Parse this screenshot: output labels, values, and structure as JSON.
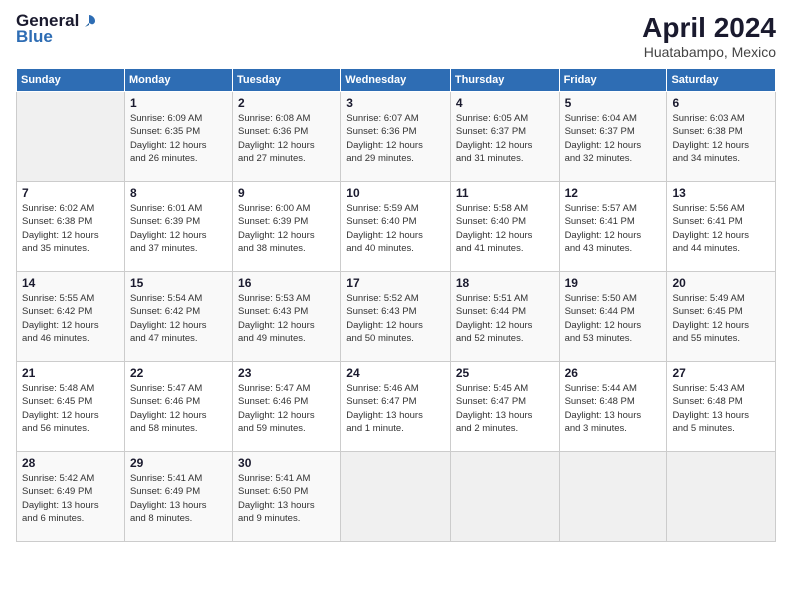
{
  "app": {
    "logo_general": "General",
    "logo_blue": "Blue",
    "title": "April 2024",
    "subtitle": "Huatabampo, Mexico"
  },
  "calendar": {
    "headers": [
      "Sunday",
      "Monday",
      "Tuesday",
      "Wednesday",
      "Thursday",
      "Friday",
      "Saturday"
    ],
    "weeks": [
      [
        {
          "day": "",
          "info": ""
        },
        {
          "day": "1",
          "info": "Sunrise: 6:09 AM\nSunset: 6:35 PM\nDaylight: 12 hours\nand 26 minutes."
        },
        {
          "day": "2",
          "info": "Sunrise: 6:08 AM\nSunset: 6:36 PM\nDaylight: 12 hours\nand 27 minutes."
        },
        {
          "day": "3",
          "info": "Sunrise: 6:07 AM\nSunset: 6:36 PM\nDaylight: 12 hours\nand 29 minutes."
        },
        {
          "day": "4",
          "info": "Sunrise: 6:05 AM\nSunset: 6:37 PM\nDaylight: 12 hours\nand 31 minutes."
        },
        {
          "day": "5",
          "info": "Sunrise: 6:04 AM\nSunset: 6:37 PM\nDaylight: 12 hours\nand 32 minutes."
        },
        {
          "day": "6",
          "info": "Sunrise: 6:03 AM\nSunset: 6:38 PM\nDaylight: 12 hours\nand 34 minutes."
        }
      ],
      [
        {
          "day": "7",
          "info": "Sunrise: 6:02 AM\nSunset: 6:38 PM\nDaylight: 12 hours\nand 35 minutes."
        },
        {
          "day": "8",
          "info": "Sunrise: 6:01 AM\nSunset: 6:39 PM\nDaylight: 12 hours\nand 37 minutes."
        },
        {
          "day": "9",
          "info": "Sunrise: 6:00 AM\nSunset: 6:39 PM\nDaylight: 12 hours\nand 38 minutes."
        },
        {
          "day": "10",
          "info": "Sunrise: 5:59 AM\nSunset: 6:40 PM\nDaylight: 12 hours\nand 40 minutes."
        },
        {
          "day": "11",
          "info": "Sunrise: 5:58 AM\nSunset: 6:40 PM\nDaylight: 12 hours\nand 41 minutes."
        },
        {
          "day": "12",
          "info": "Sunrise: 5:57 AM\nSunset: 6:41 PM\nDaylight: 12 hours\nand 43 minutes."
        },
        {
          "day": "13",
          "info": "Sunrise: 5:56 AM\nSunset: 6:41 PM\nDaylight: 12 hours\nand 44 minutes."
        }
      ],
      [
        {
          "day": "14",
          "info": "Sunrise: 5:55 AM\nSunset: 6:42 PM\nDaylight: 12 hours\nand 46 minutes."
        },
        {
          "day": "15",
          "info": "Sunrise: 5:54 AM\nSunset: 6:42 PM\nDaylight: 12 hours\nand 47 minutes."
        },
        {
          "day": "16",
          "info": "Sunrise: 5:53 AM\nSunset: 6:43 PM\nDaylight: 12 hours\nand 49 minutes."
        },
        {
          "day": "17",
          "info": "Sunrise: 5:52 AM\nSunset: 6:43 PM\nDaylight: 12 hours\nand 50 minutes."
        },
        {
          "day": "18",
          "info": "Sunrise: 5:51 AM\nSunset: 6:44 PM\nDaylight: 12 hours\nand 52 minutes."
        },
        {
          "day": "19",
          "info": "Sunrise: 5:50 AM\nSunset: 6:44 PM\nDaylight: 12 hours\nand 53 minutes."
        },
        {
          "day": "20",
          "info": "Sunrise: 5:49 AM\nSunset: 6:45 PM\nDaylight: 12 hours\nand 55 minutes."
        }
      ],
      [
        {
          "day": "21",
          "info": "Sunrise: 5:48 AM\nSunset: 6:45 PM\nDaylight: 12 hours\nand 56 minutes."
        },
        {
          "day": "22",
          "info": "Sunrise: 5:47 AM\nSunset: 6:46 PM\nDaylight: 12 hours\nand 58 minutes."
        },
        {
          "day": "23",
          "info": "Sunrise: 5:47 AM\nSunset: 6:46 PM\nDaylight: 12 hours\nand 59 minutes."
        },
        {
          "day": "24",
          "info": "Sunrise: 5:46 AM\nSunset: 6:47 PM\nDaylight: 13 hours\nand 1 minute."
        },
        {
          "day": "25",
          "info": "Sunrise: 5:45 AM\nSunset: 6:47 PM\nDaylight: 13 hours\nand 2 minutes."
        },
        {
          "day": "26",
          "info": "Sunrise: 5:44 AM\nSunset: 6:48 PM\nDaylight: 13 hours\nand 3 minutes."
        },
        {
          "day": "27",
          "info": "Sunrise: 5:43 AM\nSunset: 6:48 PM\nDaylight: 13 hours\nand 5 minutes."
        }
      ],
      [
        {
          "day": "28",
          "info": "Sunrise: 5:42 AM\nSunset: 6:49 PM\nDaylight: 13 hours\nand 6 minutes."
        },
        {
          "day": "29",
          "info": "Sunrise: 5:41 AM\nSunset: 6:49 PM\nDaylight: 13 hours\nand 8 minutes."
        },
        {
          "day": "30",
          "info": "Sunrise: 5:41 AM\nSunset: 6:50 PM\nDaylight: 13 hours\nand 9 minutes."
        },
        {
          "day": "",
          "info": ""
        },
        {
          "day": "",
          "info": ""
        },
        {
          "day": "",
          "info": ""
        },
        {
          "day": "",
          "info": ""
        }
      ]
    ]
  }
}
